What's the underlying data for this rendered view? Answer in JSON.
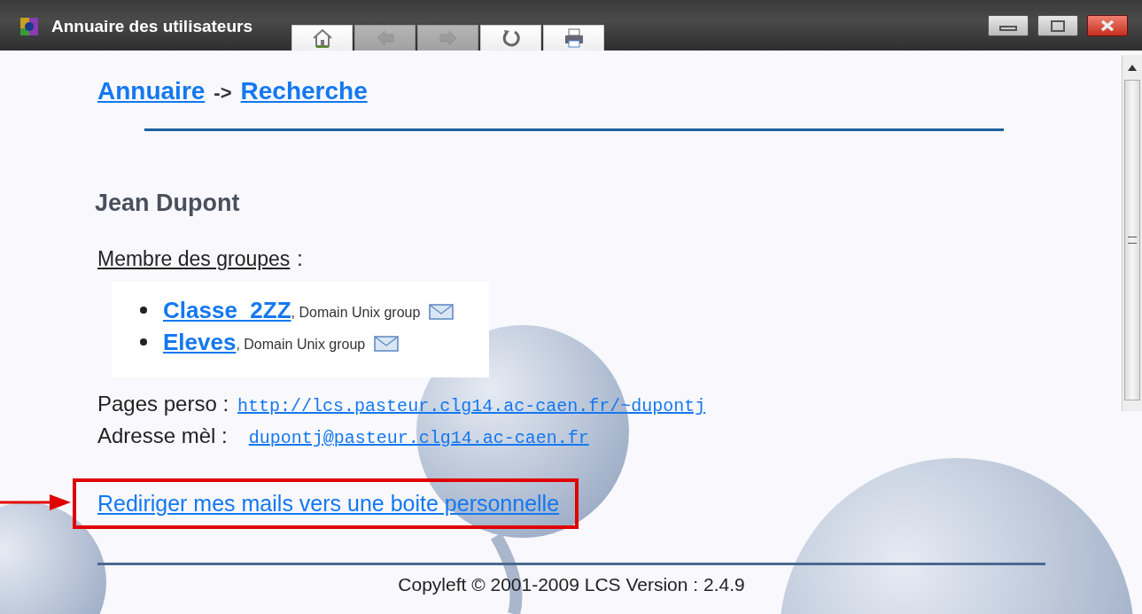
{
  "window": {
    "title": "Annuaire des utilisateurs"
  },
  "toolbar": [
    {
      "kind": "home",
      "disabled": false
    },
    {
      "kind": "back",
      "disabled": true
    },
    {
      "kind": "forward",
      "disabled": true
    },
    {
      "kind": "reload",
      "disabled": false
    },
    {
      "kind": "print",
      "disabled": false
    }
  ],
  "breadcrumb": {
    "items": [
      "Annuaire",
      "Recherche"
    ],
    "separator": "->"
  },
  "user": {
    "name": "Jean Dupont"
  },
  "groups_heading": {
    "label": "Membre des groupes",
    "suffix": ":"
  },
  "groups": [
    {
      "name": "Classe_2ZZ",
      "description": ", Domain Unix group"
    },
    {
      "name": "Eleves",
      "description": ", Domain Unix group"
    }
  ],
  "fields": [
    {
      "label": "Pages perso :",
      "value": "http://lcs.pasteur.clg14.ac-caen.fr/~dupontj"
    },
    {
      "label": "Adresse mèl :",
      "value": "dupontj@pasteur.clg14.ac-caen.fr"
    }
  ],
  "redirect_link": {
    "label": "Rediriger mes mails vers une boite personnelle",
    "highlighted": true
  },
  "footer": "Copyleft © 2001-2009 LCS Version : 2.4.9"
}
